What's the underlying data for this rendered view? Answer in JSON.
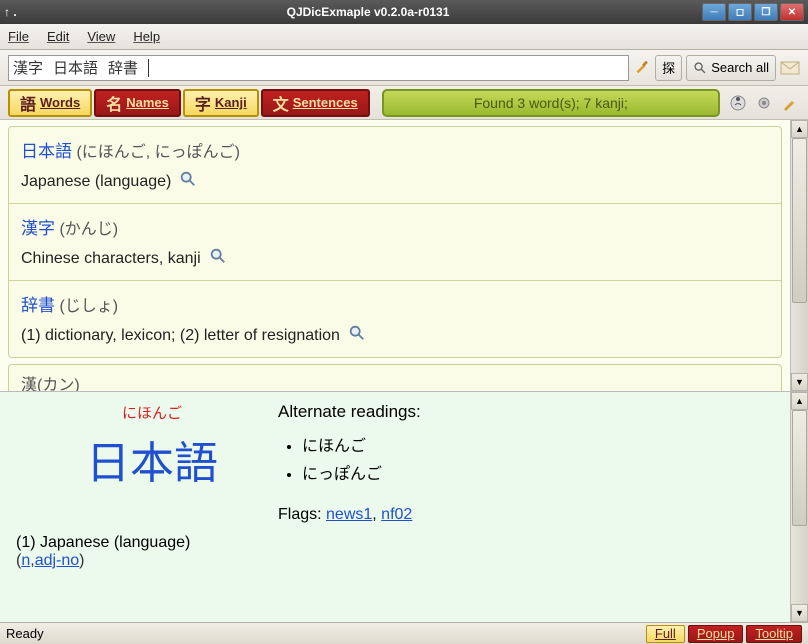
{
  "window": {
    "title": "QJDicExmaple v0.2.0a-r0131",
    "left_hint": "↑ ."
  },
  "menubar": {
    "file": "File",
    "edit": "Edit",
    "view": "View",
    "help": "Help"
  },
  "search": {
    "terms": [
      "漢字",
      "日本語",
      "辞書"
    ],
    "go_label": "探",
    "search_all_label": "Search all"
  },
  "tabs": {
    "words": {
      "jp": "語",
      "label": "Words"
    },
    "names": {
      "jp": "名",
      "label": "Names"
    },
    "kanji": {
      "jp": "字",
      "label": "Kanji"
    },
    "sentences": {
      "jp": "文",
      "label": "Sentences"
    }
  },
  "status_pill": "Found 3 word(s); 7 kanji;",
  "results": [
    {
      "headword": "日本語",
      "reading": "(にほんご, にっぽんご)",
      "meaning": "Japanese (language)"
    },
    {
      "headword": "漢字",
      "reading": "(かんじ)",
      "meaning": "Chinese characters, kanji"
    },
    {
      "headword": "辞書",
      "reading": "(じしょ)",
      "meaning": "(1) dictionary, lexicon; (2) letter of resignation"
    }
  ],
  "partial_result": "漢(カン)",
  "detail": {
    "furigana": "にほんご",
    "kanji": "日本語",
    "alt_heading": "Alternate readings:",
    "alt_readings": [
      "にほんご",
      "にっぽんご"
    ],
    "flags_label": "Flags:",
    "flags": [
      "news1",
      "nf02"
    ],
    "meaning": "(1) Japanese (language)",
    "pos_open": "(",
    "pos1": "n",
    "pos_sep": ",",
    "pos2": "adj-no",
    "pos_close": ")"
  },
  "statusbar": {
    "ready": "Ready",
    "modes": {
      "full": "Full",
      "popup": "Popup",
      "tooltip": "Tooltip"
    }
  }
}
